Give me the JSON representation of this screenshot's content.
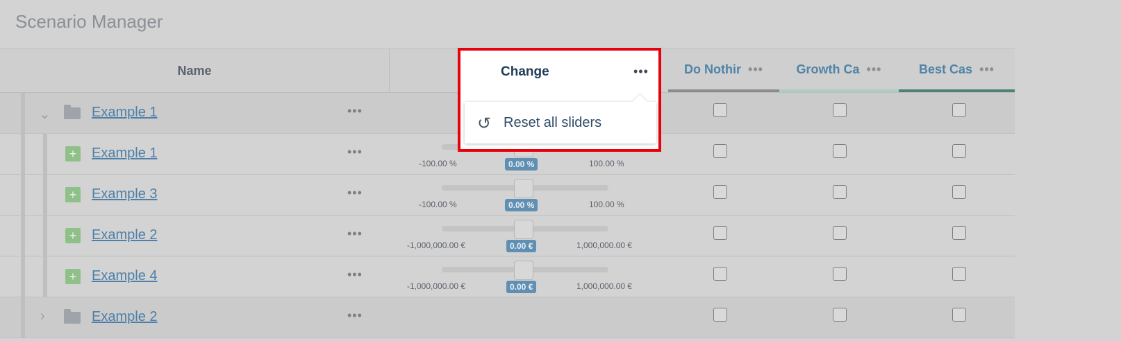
{
  "app": {
    "title": "Scenario Manager"
  },
  "table": {
    "name_header": "Name",
    "change_header": "Change",
    "scenarios": [
      {
        "label": "Do Nothir",
        "underline_color": "#8c8c8c"
      },
      {
        "label": "Growth Ca",
        "underline_color": "#aacdc4"
      },
      {
        "label": "Best Cas",
        "underline_color": "#4f7f76"
      }
    ],
    "dots": "•••"
  },
  "popup": {
    "menu_item": "Reset all sliders",
    "icon": "reset-icon"
  },
  "rows": [
    {
      "name": "Example 1",
      "type": "folder",
      "expanded": true
    },
    {
      "name": "Example 1",
      "type": "item",
      "slider": {
        "min": "-100.00 %",
        "value": "0.00 %",
        "max": "100.00 %"
      }
    },
    {
      "name": "Example 3",
      "type": "item",
      "slider": {
        "min": "-100.00 %",
        "value": "0.00 %",
        "max": "100.00 %"
      }
    },
    {
      "name": "Example 2",
      "type": "item",
      "slider": {
        "min": "-1,000,000.00 €",
        "value": "0.00 €",
        "max": "1,000,000.00 €"
      }
    },
    {
      "name": "Example 4",
      "type": "item",
      "slider": {
        "min": "-1,000,000.00 €",
        "value": "0.00 €",
        "max": "1,000,000.00 €"
      }
    },
    {
      "name": "Example 2",
      "type": "folder",
      "expanded": false
    }
  ]
}
